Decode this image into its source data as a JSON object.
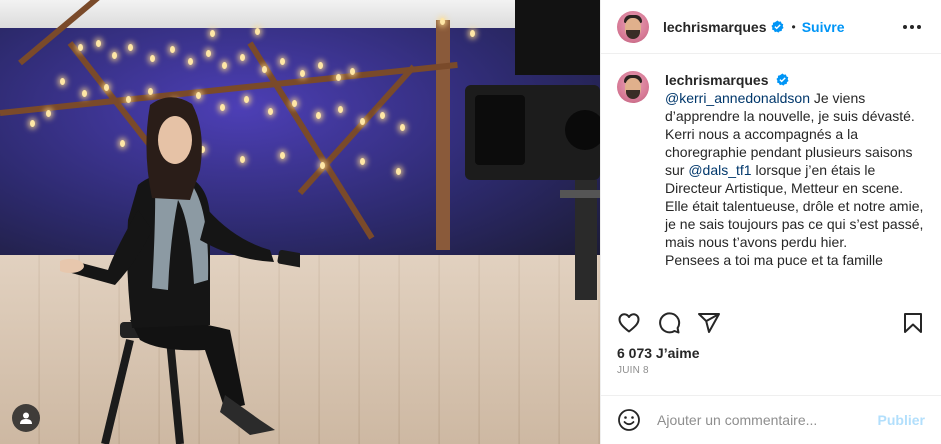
{
  "post": {
    "username": "lechrismarques",
    "follow_label": "Suivre",
    "separator": "•",
    "caption_mention": "@kerri_annedonaldson",
    "caption_part1": " Je viens d’apprendre la nouvelle, je suis dévasté.\nKerri nous a accompagnés a la choregraphie pendant plusieurs saisons sur ",
    "caption_mention2": "@dals_tf1",
    "caption_part2": " lorsque j’en étais le Directeur Artistique, Metteur en scene. Elle était talentueuse, drôle et notre amie, je ne sais toujours pas ce qui s’est passé, mais nous t’avons perdu hier.\nPensees a toi ma puce et ta famille",
    "likes": "6 073 J’aime",
    "date": "JUIN 8"
  },
  "comment": {
    "placeholder": "Ajouter un commentaire...",
    "publish_label": "Publier"
  },
  "icons": {
    "verified": "verified-badge-icon",
    "more": "more-options-icon",
    "like": "heart-icon",
    "comment": "comment-icon",
    "share": "share-icon",
    "save": "bookmark-icon",
    "emoji": "emoji-icon",
    "tag": "user-tag-icon"
  },
  "colors": {
    "link": "#0095f6",
    "mention": "#00376b",
    "muted": "#8e8e8e",
    "publish_disabled": "#b2dffc",
    "verified": "#0095f6"
  }
}
